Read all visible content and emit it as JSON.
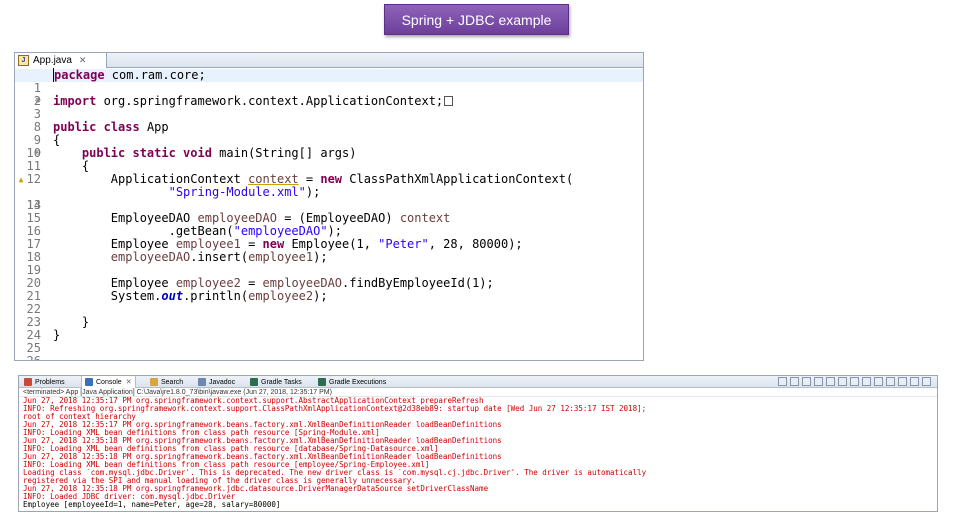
{
  "title": "Spring + JDBC example",
  "editor": {
    "tab_label": "App.java",
    "lines": [
      {
        "num": "1"
      },
      {
        "num": "2"
      },
      {
        "num": "3"
      },
      {
        "num": "8"
      },
      {
        "num": "9"
      },
      {
        "num": "10"
      },
      {
        "num": "11"
      },
      {
        "num": "12"
      },
      {
        "num": "13"
      },
      {
        "num": "14"
      },
      {
        "num": "15"
      },
      {
        "num": "16"
      },
      {
        "num": "17"
      },
      {
        "num": "18"
      },
      {
        "num": "19"
      },
      {
        "num": "20"
      },
      {
        "num": "21"
      },
      {
        "num": "22"
      },
      {
        "num": "23"
      },
      {
        "num": "24"
      },
      {
        "num": "25"
      },
      {
        "num": "26"
      }
    ],
    "code": {
      "l1_kw": "package",
      "l1_rest": " com.ram.core;",
      "l3_kw": "import",
      "l3_rest": " org.springframework.context.ApplicationContext;",
      "l9_kw1": "public",
      "l9_kw2": "class",
      "l9_rest": " App",
      "l10": "{",
      "l11_kw": "public static void",
      "l11_rest": " main(String[] args)",
      "l12": "    {",
      "l13_a": "        ApplicationContext ",
      "l13_var": "context",
      "l13_b": " = ",
      "l13_kw": "new",
      "l13_c": " ClassPathXmlApplicationContext(",
      "l14_str": "\"Spring-Module.xml\"",
      "l14_rest": ");",
      "l16_a": "        EmployeeDAO ",
      "l16_var": "employeeDAO",
      "l16_b": " = (EmployeeDAO) ",
      "l16_var2": "context",
      "l17_a": "                .getBean(",
      "l17_str": "\"employeeDAO\"",
      "l17_b": ");",
      "l18_a": "        Employee ",
      "l18_var": "employee1",
      "l18_b": " = ",
      "l18_kw": "new",
      "l18_c": " Employee(1, ",
      "l18_str": "\"Peter\"",
      "l18_d": ", 28, 80000);",
      "l19_var": "employeeDAO",
      "l19_a": ".insert(",
      "l19_var2": "employee1",
      "l19_b": ");",
      "l21_a": "        Employee ",
      "l21_var": "employee2",
      "l21_b": " = ",
      "l21_var2": "employeeDAO",
      "l21_c": ".findByEmployeeId(1);",
      "l22_a": "        System.",
      "l22_stat": "out",
      "l22_b": ".println(",
      "l22_var": "employee2",
      "l22_c": ");",
      "l24": "    }",
      "l25": "}"
    }
  },
  "console": {
    "tabs": [
      "Problems",
      "Console",
      "Search",
      "Javadoc",
      "Gradle Tasks",
      "Gradle Executions"
    ],
    "terminated": "<terminated> App [Java Application] C:\\Java\\jre1.8.0_73\\bin\\javaw.exe (Jun 27, 2018, 12:35:17 PM)",
    "lines": [
      "Jun 27, 2018 12:35:17 PM org.springframework.context.support.AbstractApplicationContext prepareRefresh",
      "INFO: Refreshing org.springframework.context.support.ClassPathXmlApplicationContext@2d38eb89: startup date [Wed Jun 27 12:35:17 IST 2018];",
      "root of context hierarchy",
      "Jun 27, 2018 12:35:17 PM org.springframework.beans.factory.xml.XmlBeanDefinitionReader loadBeanDefinitions",
      "INFO: Loading XML bean definitions from class path resource [Spring-Module.xml]",
      "Jun 27, 2018 12:35:18 PM org.springframework.beans.factory.xml.XmlBeanDefinitionReader loadBeanDefinitions",
      "INFO: Loading XML bean definitions from class path resource [database/Spring-Datasource.xml]",
      "Jun 27, 2018 12:35:18 PM org.springframework.beans.factory.xml.XmlBeanDefinitionReader loadBeanDefinitions",
      "INFO: Loading XML bean definitions from class path resource [employee/Spring-Employee.xml]",
      "Loading class `com.mysql.jdbc.Driver'. This is deprecated. The new driver class is `com.mysql.cj.jdbc.Driver'. The driver is automatically",
      "registered via the SPI and manual loading of the driver class is generally unnecessary.",
      "Jun 27, 2018 12:35:18 PM org.springframework.jdbc.datasource.DriverManagerDataSource setDriverClassName",
      "INFO: Loaded JDBC driver: com.mysql.jdbc.Driver"
    ],
    "output": "Employee [employeeId=1, name=Peter, age=28, salary=80000]"
  }
}
